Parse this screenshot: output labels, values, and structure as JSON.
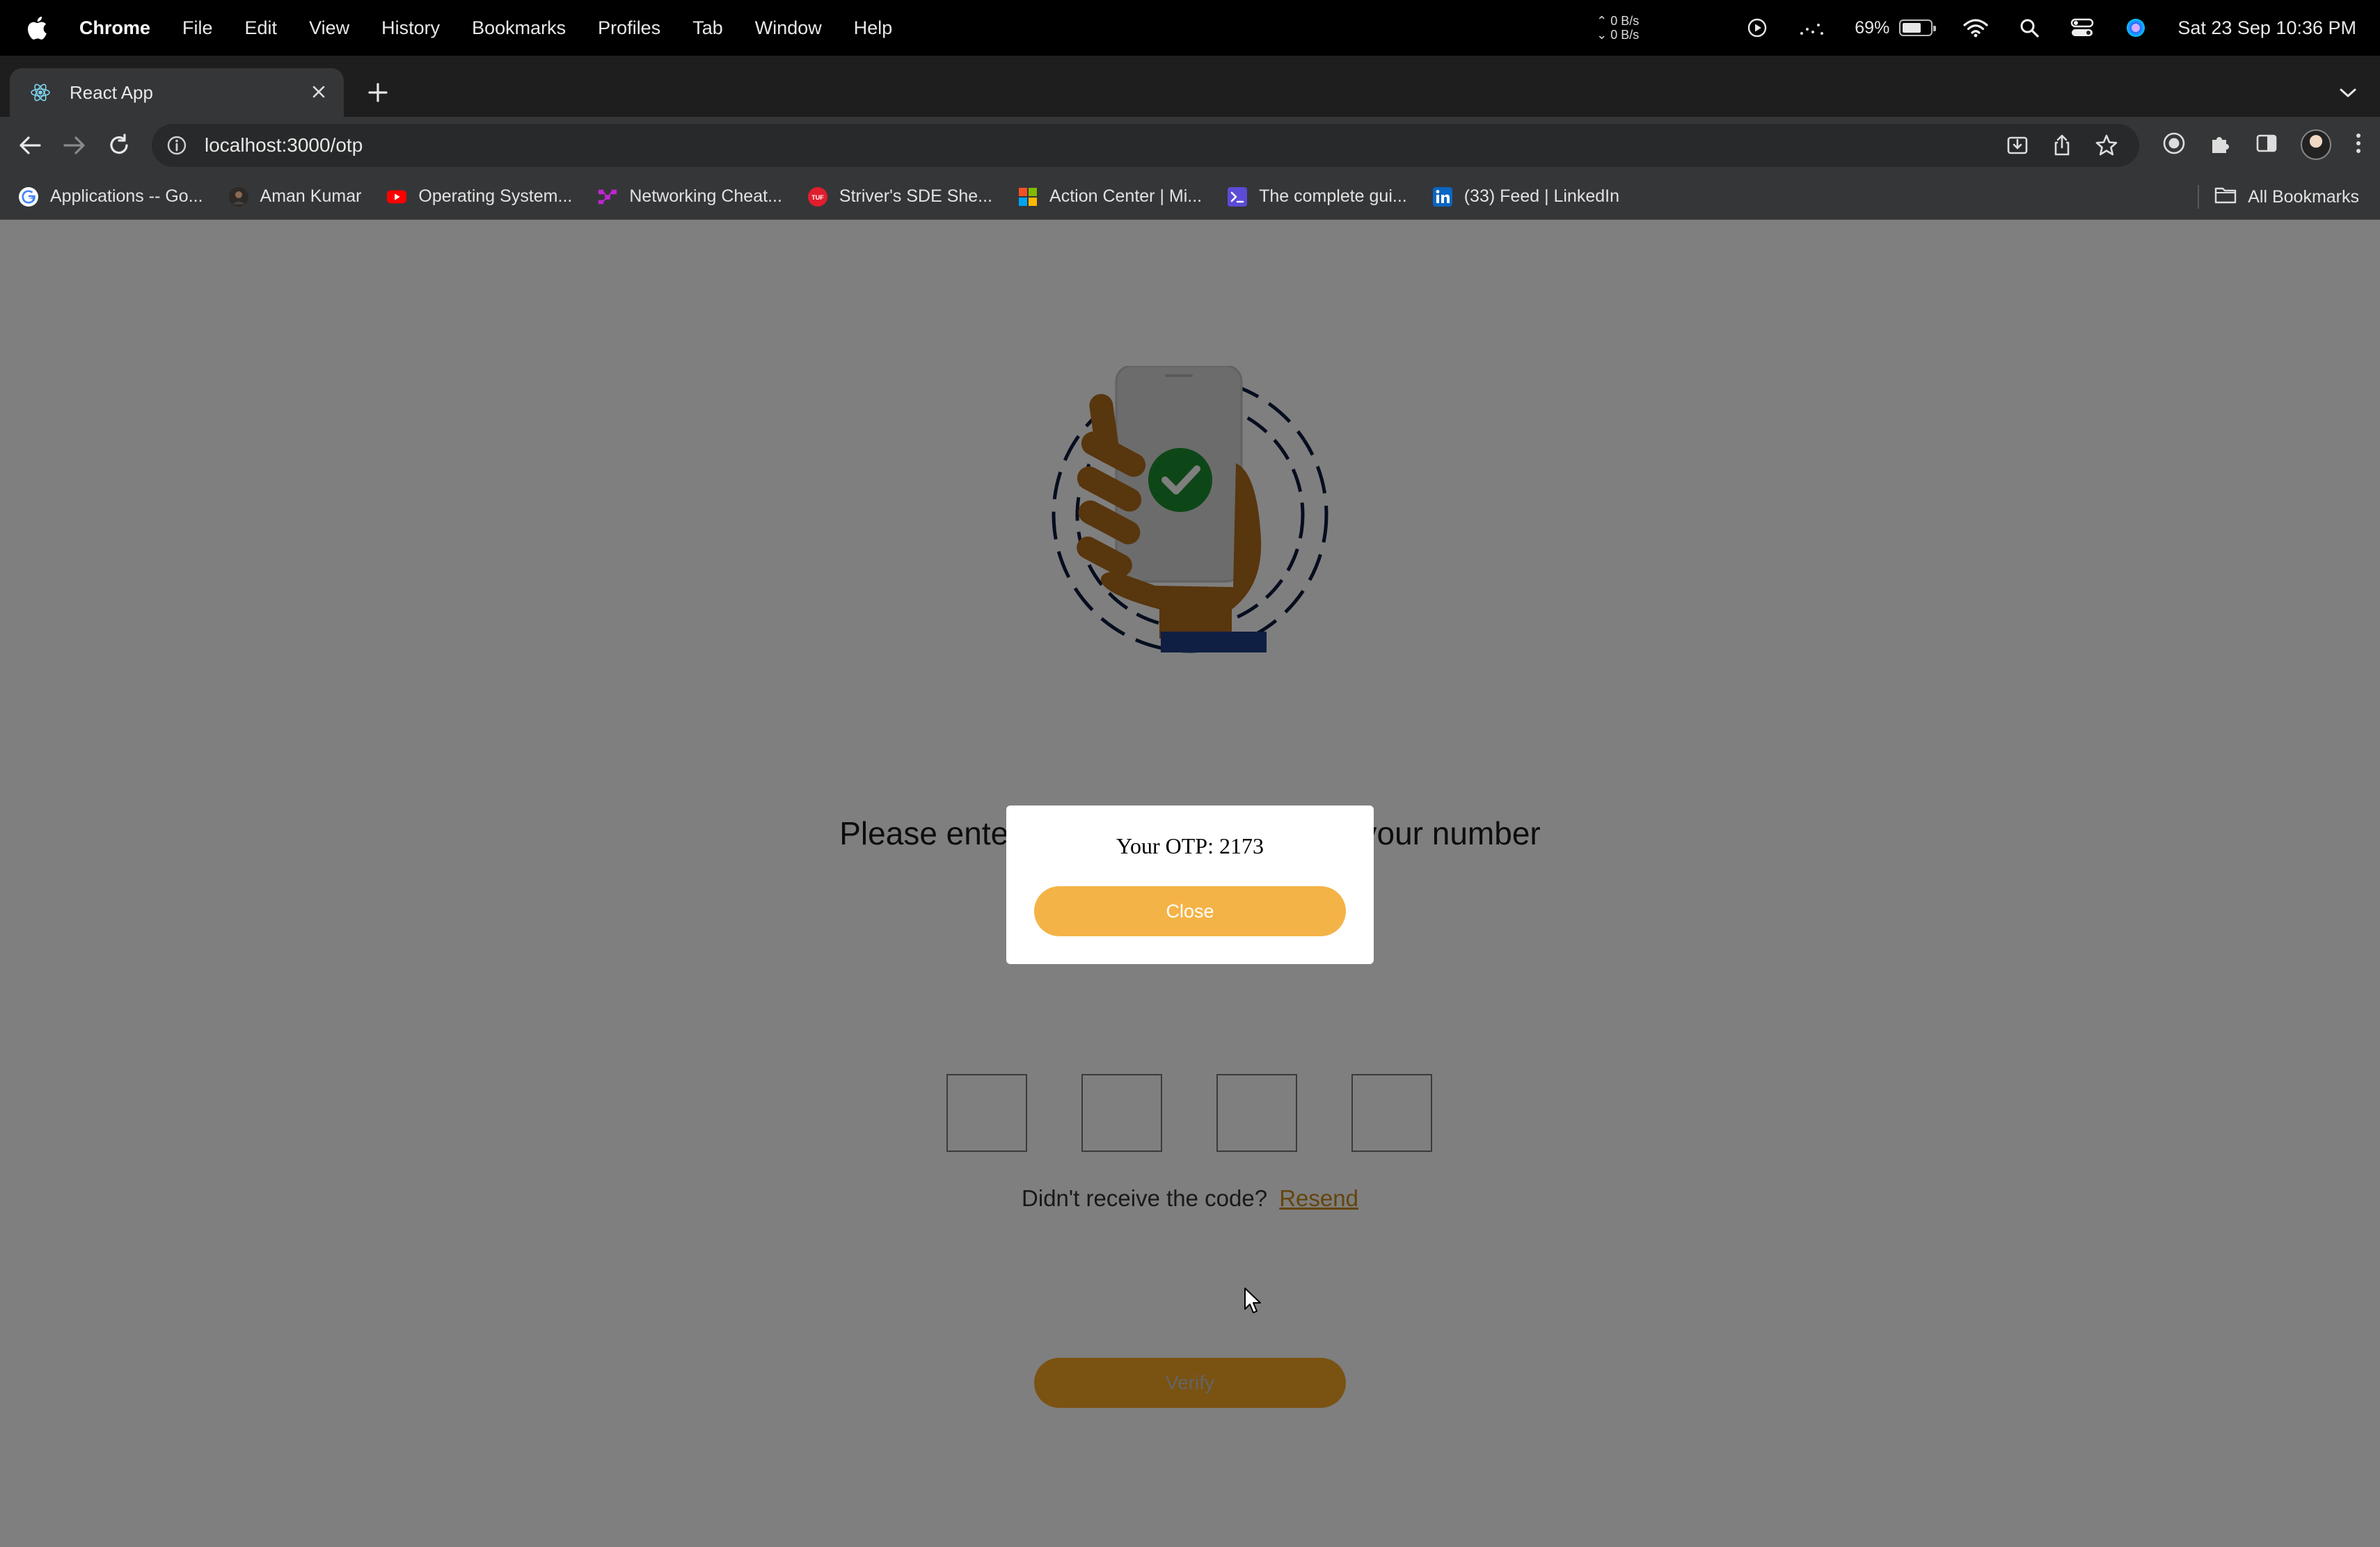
{
  "menubar": {
    "app_name": "Chrome",
    "items": [
      "File",
      "Edit",
      "View",
      "History",
      "Bookmarks",
      "Profiles",
      "Tab",
      "Window",
      "Help"
    ],
    "net_up": "0 B/s",
    "net_down": "0 B/s",
    "battery_pct": "69%",
    "battery_level": 0.69,
    "clock": "Sat 23 Sep  10:36 PM"
  },
  "tab": {
    "title": "React App",
    "favicon": "react-icon"
  },
  "toolbar": {
    "url": "localhost:3000/otp"
  },
  "bookmarks": {
    "items": [
      {
        "label": "Applications -- Go...",
        "icon": "google-icon",
        "color": "#ffffff"
      },
      {
        "label": "Aman Kumar",
        "icon": "profile-photo-icon",
        "color": "#5a4a3a"
      },
      {
        "label": "Operating System...",
        "icon": "youtube-icon",
        "color": "#ff0000"
      },
      {
        "label": "Networking Cheat...",
        "icon": "network-icon",
        "color": "#c026d3"
      },
      {
        "label": "Striver's SDE She...",
        "icon": "tuf-icon",
        "color": "#e11d2e"
      },
      {
        "label": "Action Center | Mi...",
        "icon": "microsoft-icon",
        "color": "#f25022"
      },
      {
        "label": "The complete gui...",
        "icon": "terminal-icon",
        "color": "#5b4bd6"
      },
      {
        "label": "(33) Feed | LinkedIn",
        "icon": "linkedin-icon",
        "color": "#0a66c2"
      }
    ],
    "all_label": "All Bookmarks"
  },
  "page": {
    "heading": "Please enter the 4-digit code sent to your number",
    "otp_digits": [
      "",
      "",
      "",
      ""
    ],
    "resend_prompt": "Didn't receive the code?",
    "resend_link": "Resend",
    "verify_label": "Verify",
    "accent_color": "#f4a525"
  },
  "modal": {
    "message": "Your OTP: 2173",
    "close_label": "Close"
  }
}
